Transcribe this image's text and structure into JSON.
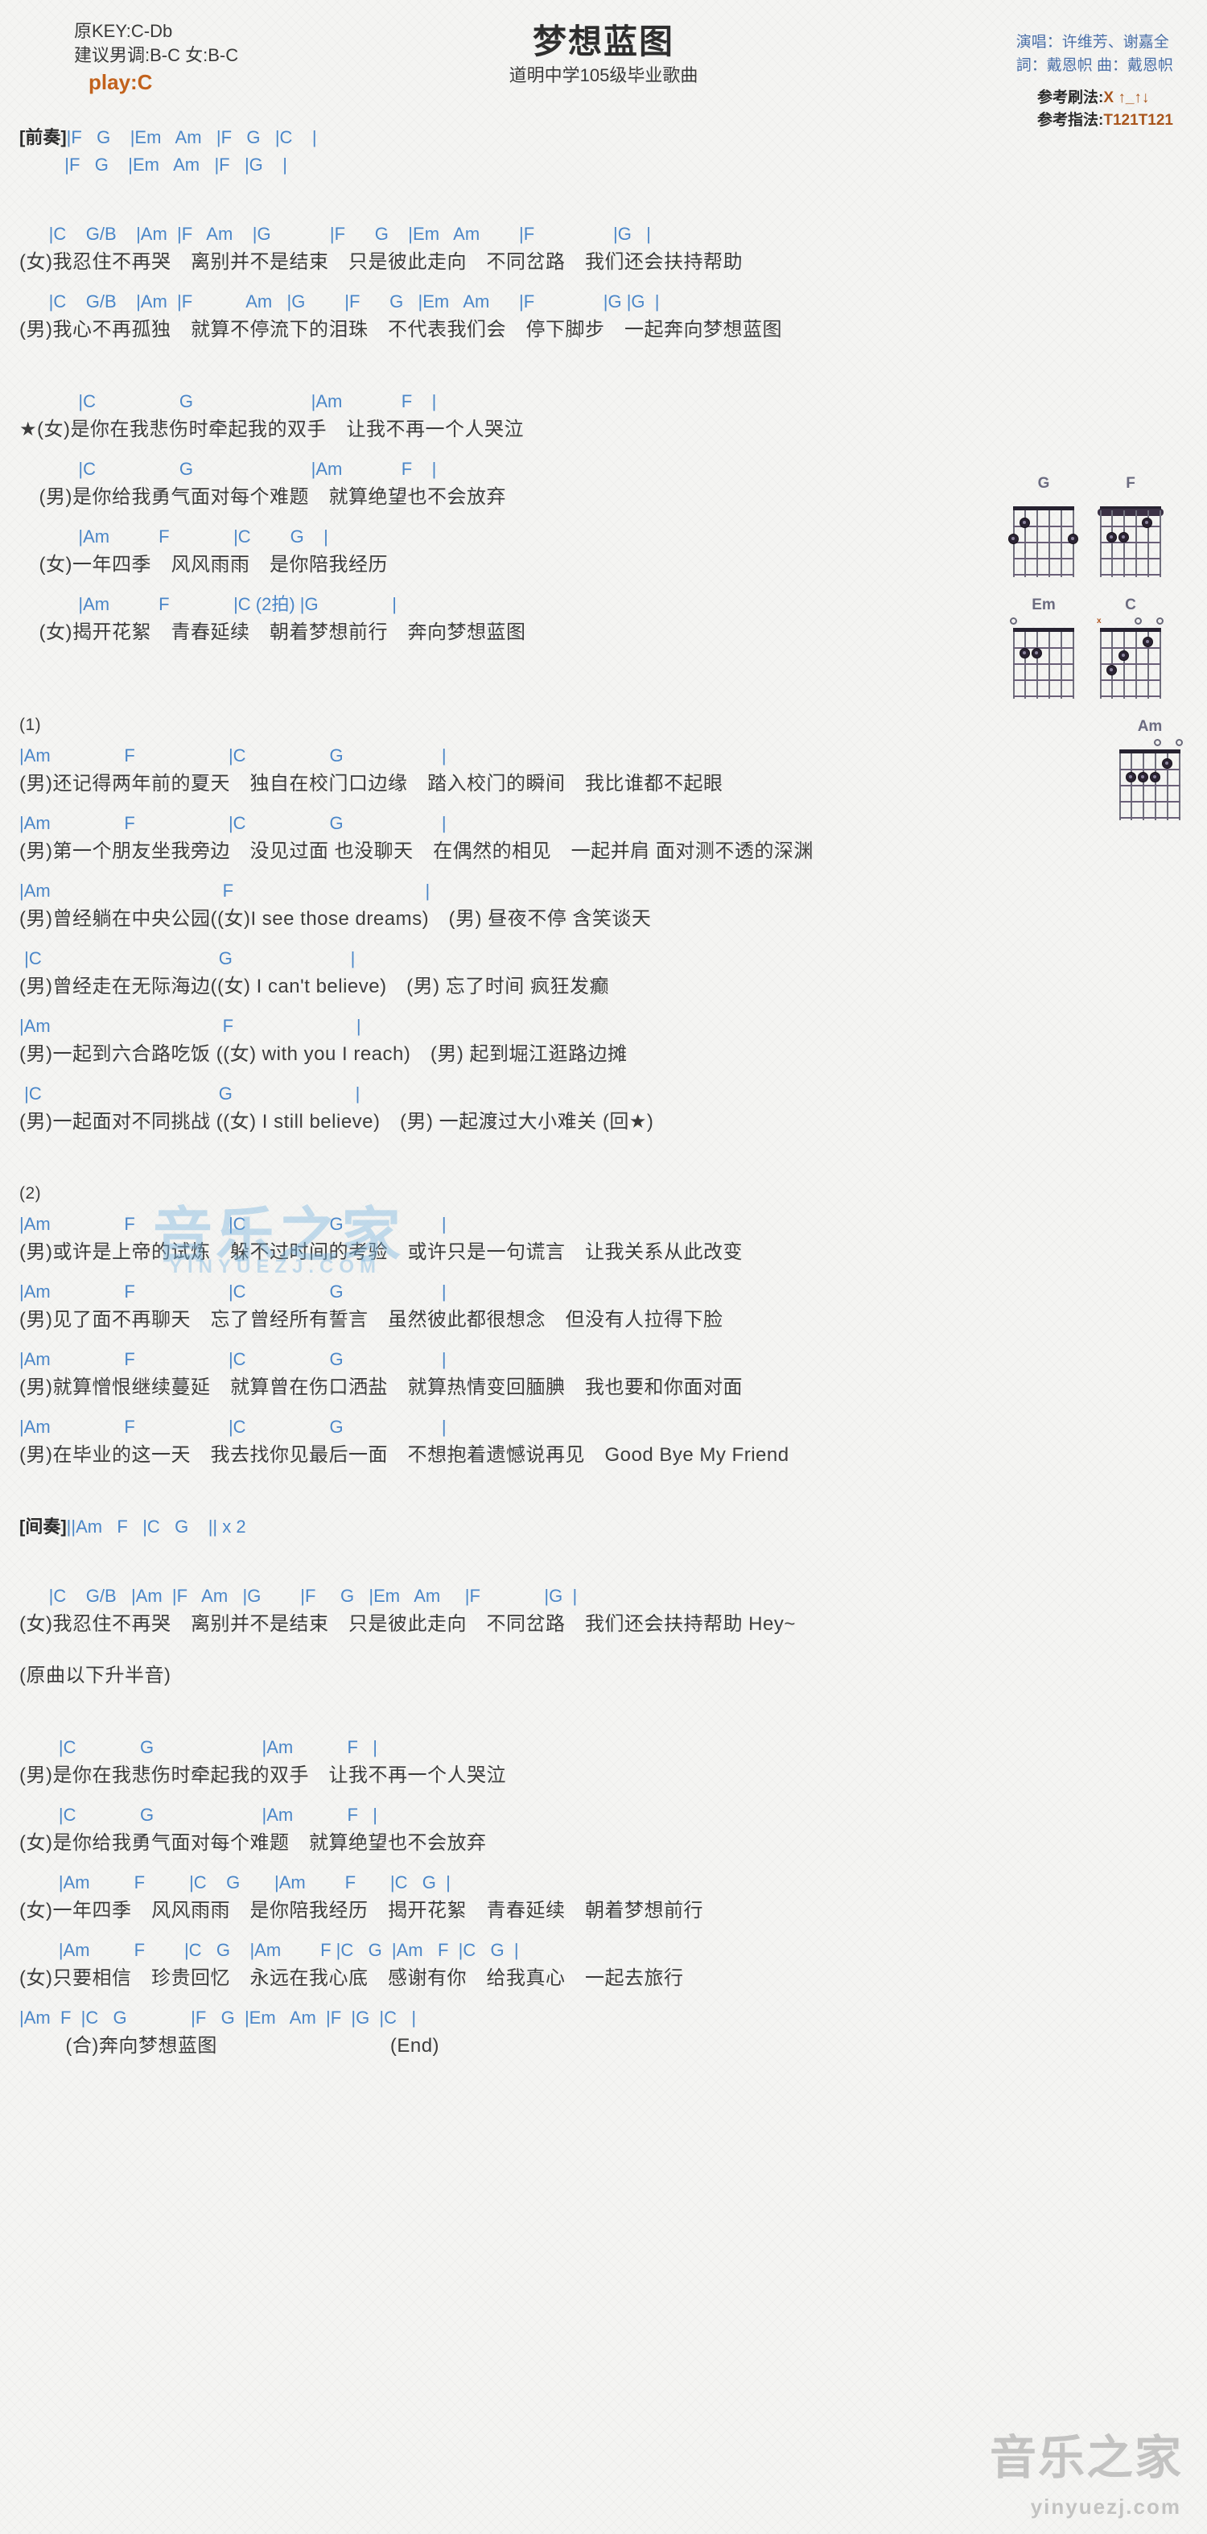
{
  "header": {
    "orig_key": "原KEY:C-Db",
    "suggest_key": "建议男调:B-C 女:B-C",
    "play": "play:C",
    "title": "梦想蓝图",
    "subtitle": "道明中学105级毕业歌曲",
    "singer": "演唱：许维芳、谢嘉全",
    "writer": "詞：戴恩帜  曲：戴恩帜",
    "strum_label": "参考刷法:",
    "strum_value": "X ↑_↑↓",
    "finger_label": "参考指法:",
    "finger_value": "T121T121"
  },
  "colors": {
    "chord": "#4a86c8",
    "lyric": "#3d3d3d",
    "accent": "#c2621c",
    "credit": "#4a6fa8",
    "watermark": "#7ab6e0"
  },
  "intro": {
    "label": "[前奏]",
    "line1": "|F   G    |Em   Am   |F   G   |C    |",
    "line2": "|F   G    |Em   Am   |F   |G    |"
  },
  "sections": [
    {
      "name": "verse-a",
      "rows": [
        {
          "type": "chord",
          "text": "      |C    G/B    |Am  |F   Am    |G            |F      G    |Em   Am        |F                |G   |"
        },
        {
          "type": "lyric",
          "text": "(女)我忍住不再哭　离别并不是结束　只是彼此走向　不同岔路　我们还会扶持帮助"
        },
        {
          "type": "chord",
          "text": "      |C    G/B    |Am  |F           Am   |G        |F      G   |Em   Am      |F              |G |G  |"
        },
        {
          "type": "lyric",
          "text": "(男)我心不再孤独　就算不停流下的泪珠　不代表我们会　停下脚步　一起奔向梦想蓝图"
        }
      ]
    },
    {
      "name": "chorus",
      "rows": [
        {
          "type": "chord",
          "text": "            |C                 G                        |Am            F    |"
        },
        {
          "type": "lyric",
          "text": "★(女)是你在我悲伤时牵起我的双手　让我不再一个人哭泣"
        },
        {
          "type": "chord",
          "text": "            |C                 G                        |Am            F    |"
        },
        {
          "type": "lyric",
          "text": "　(男)是你给我勇气面对每个难题　就算绝望也不会放弃"
        },
        {
          "type": "chord",
          "text": "            |Am          F             |C        G    |"
        },
        {
          "type": "lyric",
          "text": "　(女)一年四季　风风雨雨　是你陪我经历"
        },
        {
          "type": "chord",
          "text": "            |Am          F             |C (2拍) |G               |"
        },
        {
          "type": "lyric",
          "text": "　(女)揭开花絮　青春延续　朝着梦想前行　奔向梦想蓝图"
        }
      ]
    },
    {
      "name": "verse-1",
      "label": "(1)",
      "rows": [
        {
          "type": "chord",
          "text": "|Am               F                   |C                 G                    |"
        },
        {
          "type": "lyric",
          "text": "(男)还记得两年前的夏天　独自在校门口边缘　踏入校门的瞬间　我比谁都不起眼"
        },
        {
          "type": "chord",
          "text": "|Am               F                   |C                 G                    |"
        },
        {
          "type": "lyric",
          "text": "(男)第一个朋友坐我旁边　没见过面 也没聊天　在偶然的相见　一起并肩 面对测不透的深渊"
        },
        {
          "type": "chord",
          "text": "|Am                                   F                                       |"
        },
        {
          "type": "lyric",
          "text": "(男)曾经躺在中央公园((女)I see those dreams)　(男) 昼夜不停 含笑谈天"
        },
        {
          "type": "chord",
          "text": " |C                                    G                        |"
        },
        {
          "type": "lyric",
          "text": "(男)曾经走在无际海边((女) I can't believe)　(男) 忘了时间 疯狂发癫"
        },
        {
          "type": "chord",
          "text": "|Am                                   F                         |"
        },
        {
          "type": "lyric",
          "text": "(男)一起到六合路吃饭 ((女) with you I reach)　(男) 起到堀江逛路边摊"
        },
        {
          "type": "chord",
          "text": " |C                                    G                         |"
        },
        {
          "type": "lyric",
          "text": "(男)一起面对不同挑战 ((女) I still believe)　(男) 一起渡过大小难关 (回★)"
        }
      ]
    },
    {
      "name": "verse-2",
      "label": "(2)",
      "rows": [
        {
          "type": "chord",
          "text": "|Am               F                   |C                 G                    |"
        },
        {
          "type": "lyric",
          "text": "(男)或许是上帝的试炼　躲不过时间的考验　或许只是一句谎言　让我关系从此改变"
        },
        {
          "type": "chord",
          "text": "|Am               F                   |C                 G                    |"
        },
        {
          "type": "lyric",
          "text": "(男)见了面不再聊天　忘了曾经所有誓言　虽然彼此都很想念　但没有人拉得下脸"
        },
        {
          "type": "chord",
          "text": "|Am               F                   |C                 G                    |"
        },
        {
          "type": "lyric",
          "text": "(男)就算憎恨继续蔓延　就算曾在伤口洒盐　就算热情变回腼腆　我也要和你面对面"
        },
        {
          "type": "chord",
          "text": "|Am               F                   |C                 G                    |"
        },
        {
          "type": "lyric",
          "text": "(男)在毕业的这一天　我去找你见最后一面　不想抱着遗憾说再见　Good Bye My Friend"
        }
      ]
    }
  ],
  "interlude": {
    "label": "[间奏]",
    "text": "||Am   F   |C   G    || x 2"
  },
  "verse_reprise": {
    "rows": [
      {
        "type": "chord",
        "text": "      |C    G/B   |Am  |F   Am   |G        |F     G   |Em   Am     |F             |G  |"
      },
      {
        "type": "lyric",
        "text": "(女)我忍住不再哭　离别并不是结束　只是彼此走向　不同岔路　我们还会扶持帮助 Hey~"
      }
    ],
    "note": "(原曲以下升半音)"
  },
  "final_chorus": {
    "rows": [
      {
        "type": "chord",
        "text": "        |C             G                      |Am           F   |"
      },
      {
        "type": "lyric",
        "text": "(男)是你在我悲伤时牵起我的双手　让我不再一个人哭泣"
      },
      {
        "type": "chord",
        "text": "        |C             G                      |Am           F   |"
      },
      {
        "type": "lyric",
        "text": "(女)是你给我勇气面对每个难题　就算绝望也不会放弃"
      },
      {
        "type": "chord",
        "text": "        |Am         F         |C    G       |Am        F       |C   G  |"
      },
      {
        "type": "lyric",
        "text": "(女)一年四季　风风雨雨　是你陪我经历　揭开花絮　青春延续　朝着梦想前行"
      },
      {
        "type": "chord",
        "text": "        |Am         F        |C   G    |Am        F |C   G  |Am   F  |C   G  |"
      },
      {
        "type": "lyric",
        "text": "(女)只要相信　珍贵回忆　永远在我心底　感谢有你　给我真心　一起去旅行"
      },
      {
        "type": "chord",
        "text": "|Am  F  |C   G             |F   G  |Em   Am  |F  |G  |C   |"
      },
      {
        "type": "lyric",
        "text": "        (合)奔向梦想蓝图                              (End)"
      }
    ]
  },
  "diagrams": [
    {
      "name": "G",
      "open": [
        {
          "type": "none"
        }
      ],
      "barre": null
    },
    {
      "name": "F",
      "open": [],
      "barre": 1
    },
    {
      "name": "Em",
      "open": [
        {
          "type": "o"
        }
      ],
      "barre": null
    },
    {
      "name": "C",
      "open": [
        {
          "type": "x"
        },
        {
          "type": "o"
        },
        {
          "type": "o"
        }
      ],
      "barre": null
    },
    {
      "name": "Am",
      "open": [
        {
          "type": "o"
        },
        {
          "type": "o"
        }
      ],
      "barre": null
    }
  ],
  "watermark": {
    "mid_text": "音乐之家",
    "mid_sub": "YINYUEZJ.COM",
    "bot_text": "音乐之家",
    "bot_sub": "yinyuezj.com"
  }
}
